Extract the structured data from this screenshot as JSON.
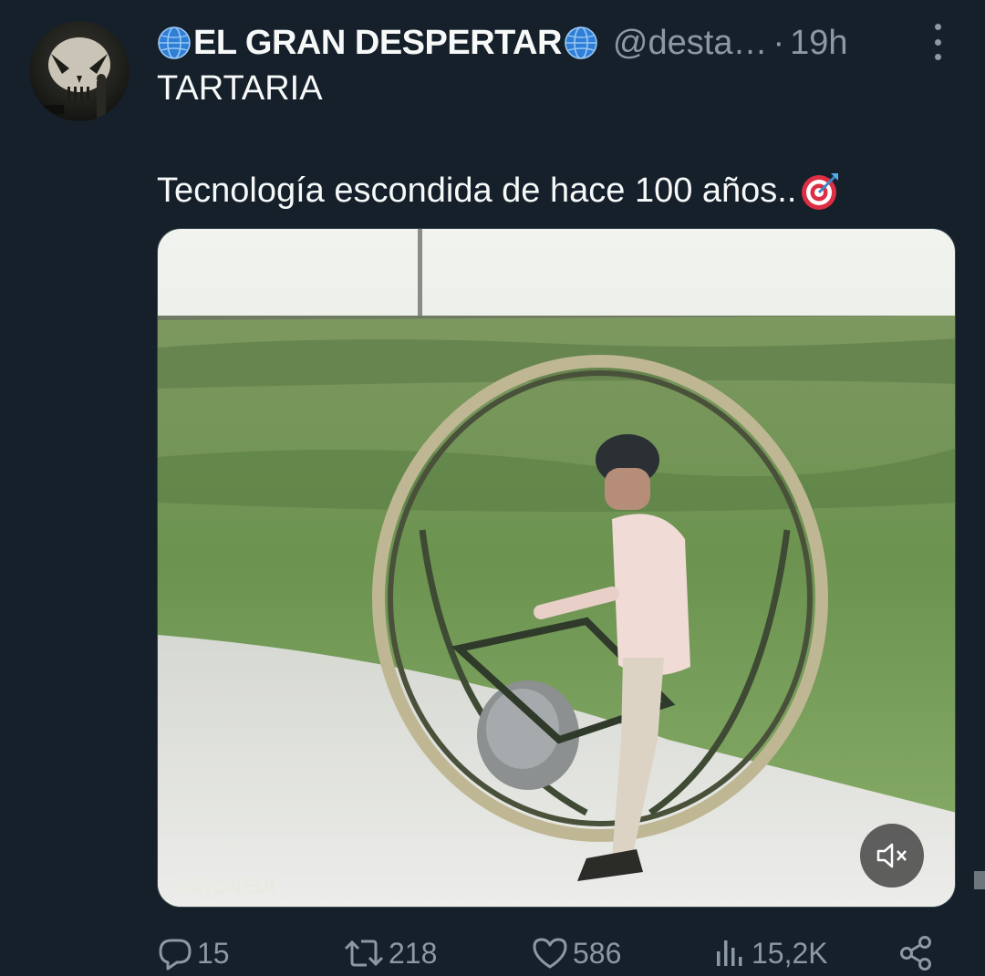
{
  "tweet": {
    "author": {
      "display_name": "EL GRAN DESPERTAR",
      "handle": "@desta…",
      "separator": "·",
      "time": "19h",
      "name_emoji_icon": "globe-icon"
    },
    "text": {
      "line1": "TARTARIA",
      "line2": "Tecnología escondida de hace 100 años..",
      "line2_emoji_icon": "direct-hit-target-icon"
    },
    "media": {
      "type": "video",
      "mute_icon": "speaker-muted-icon",
      "muted": true
    },
    "actions": {
      "reply_count": "15",
      "retweet_count": "218",
      "like_count": "586",
      "views_count": "15,2K"
    }
  },
  "colors": {
    "background": "#15202b",
    "text_primary": "#f7f9f9",
    "text_secondary": "#8b98a5",
    "border": "#38444d"
  }
}
